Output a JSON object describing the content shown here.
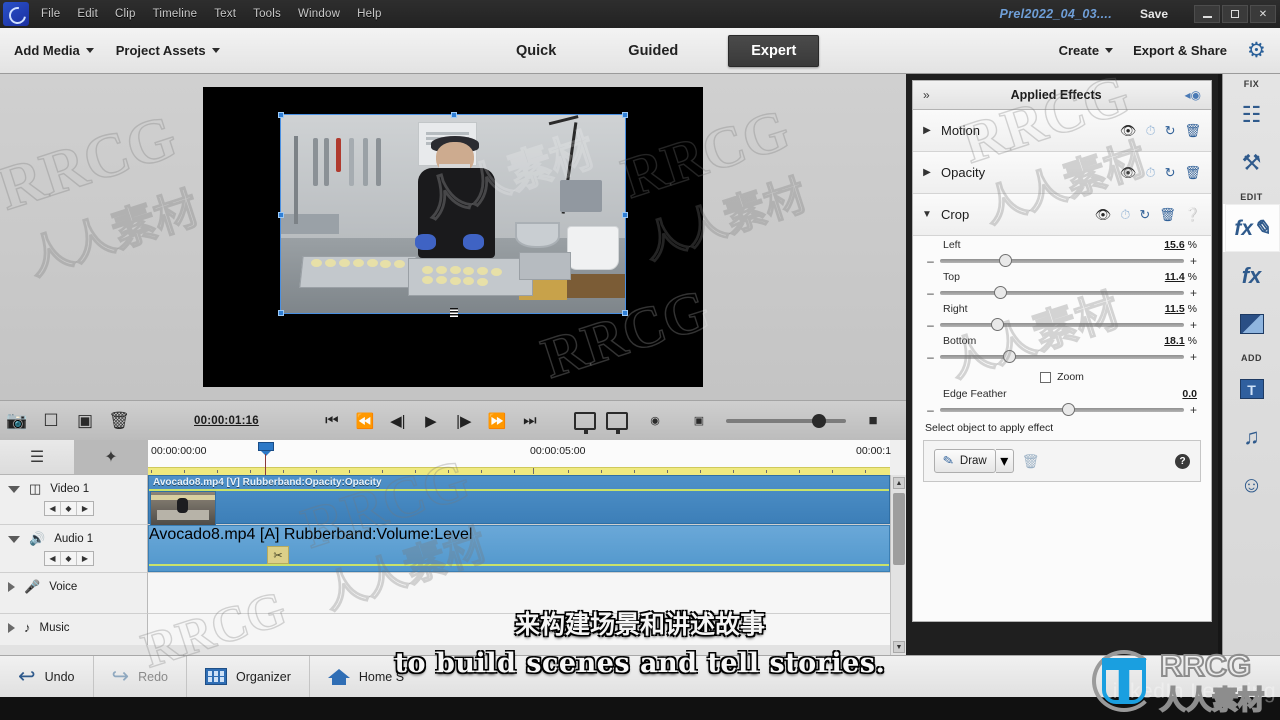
{
  "titlebar": {
    "menu": [
      "File",
      "Edit",
      "Clip",
      "Timeline",
      "Text",
      "Tools",
      "Window",
      "Help"
    ],
    "project_title": "Prel2022_04_03....",
    "save_label": "Save",
    "window_buttons": {
      "minimize": "minimize-icon",
      "maximize": "maximize-icon",
      "close": "✕"
    }
  },
  "actionbar": {
    "add_media": "Add Media",
    "project_assets": "Project Assets",
    "modes": [
      {
        "label": "Quick",
        "active": false
      },
      {
        "label": "Guided",
        "active": false
      },
      {
        "label": "Expert",
        "active": true
      }
    ],
    "create": "Create",
    "export_share": "Export & Share",
    "settings_icon": "gear-icon"
  },
  "monitor": {
    "timecode": "00:00:01:16",
    "tools": [
      "camera-snapshot-icon",
      "duplicate-icon",
      "render-icon",
      "trash-icon"
    ],
    "transport": [
      "go-to-start-icon",
      "rewind-icon",
      "step-back-icon",
      "play-icon",
      "step-forward-icon",
      "fast-forward-icon",
      "go-to-end-icon"
    ],
    "right_tools": [
      "monitor-settings-icon",
      "keyframe-monitor-icon",
      "preview-quality-icon",
      "fit-screen-icon"
    ]
  },
  "timeline": {
    "toolbar": [
      "mixer-icon",
      "transitions-icon"
    ],
    "ruler": {
      "start": "00:00:00:00",
      "mid": "00:00:05:00",
      "end": "00:00:1"
    },
    "tracks": [
      {
        "name": "Video 1",
        "icon": "video-track-icon",
        "expanded": true,
        "clip": "Avocado8.mp4 [V] Rubberband:Opacity:Opacity"
      },
      {
        "name": "Audio 1",
        "icon": "audio-track-icon",
        "expanded": true,
        "clip": "Avocado8.mp4 [A] Rubberband:Volume:Level"
      },
      {
        "name": "Voice",
        "icon": "mic-icon",
        "expanded": false,
        "clip": ""
      },
      {
        "name": "Music",
        "icon": "music-note-icon",
        "expanded": false,
        "clip": ""
      }
    ]
  },
  "applied_effects": {
    "panel_title": "Applied Effects",
    "collapse_icon": "double-chevron-right-icon",
    "keyframe_icon": "keyframe-toggle-icon",
    "effects": [
      {
        "name": "Motion",
        "expanded": false,
        "icons": [
          "eye-icon",
          "keyframe-icon",
          "reset-icon",
          "trash-icon"
        ]
      },
      {
        "name": "Opacity",
        "expanded": false,
        "icons": [
          "eye-icon",
          "keyframe-icon",
          "reset-icon",
          "trash-icon"
        ]
      },
      {
        "name": "Crop",
        "expanded": true,
        "icons": [
          "eye-icon",
          "keyframe-icon",
          "reset-icon",
          "trash-icon",
          "help-icon"
        ]
      }
    ],
    "crop_params": [
      {
        "label": "Left",
        "value": "15.6",
        "unit": "%",
        "pos": 24
      },
      {
        "label": "Top",
        "value": "11.4",
        "unit": "%",
        "pos": 22
      },
      {
        "label": "Right",
        "value": "11.5",
        "unit": "%",
        "pos": 21
      },
      {
        "label": "Bottom",
        "value": "18.1",
        "unit": "%",
        "pos": 26
      }
    ],
    "zoom_checkbox_label": "Zoom",
    "zoom_checked": false,
    "edge_feather": {
      "label": "Edge Feather",
      "value": "0.0",
      "unit": "",
      "pos": 50
    },
    "select_message": "Select object to apply effect",
    "draw": {
      "label": "Draw",
      "pen_icon": "pen-icon",
      "caret": "▾",
      "trash_icon": "trash-icon",
      "help_icon": "help-icon"
    }
  },
  "right_toolbar": [
    {
      "type": "caption",
      "label": "FIX"
    },
    {
      "type": "button",
      "name": "adjustments-icon",
      "glyph": "☰",
      "selected": false
    },
    {
      "type": "button",
      "name": "tools-wrench-icon",
      "glyph": "⚒",
      "selected": false
    },
    {
      "type": "caption",
      "label": "EDIT"
    },
    {
      "type": "button",
      "name": "applied-effects-fx-icon",
      "glyph": "fx",
      "selected": true
    },
    {
      "type": "button",
      "name": "effects-fx-icon",
      "glyph": "fx",
      "selected": false
    },
    {
      "type": "button",
      "name": "transitions-icon",
      "glyph": "◨",
      "selected": false
    },
    {
      "type": "caption",
      "label": "ADD"
    },
    {
      "type": "button",
      "name": "titles-text-icon",
      "glyph": "T",
      "selected": false
    },
    {
      "type": "button",
      "name": "music-icon",
      "glyph": "♫",
      "selected": false
    },
    {
      "type": "button",
      "name": "graphics-smiley-icon",
      "glyph": "☺",
      "selected": false
    }
  ],
  "bottombar": {
    "undo": "Undo",
    "redo": "Redo",
    "organizer": "Organizer",
    "home": "Home S"
  },
  "subtitles": {
    "chinese": "来构建场景和讲述故事",
    "english": "to build scenes and tell stories."
  },
  "watermarks": {
    "brand": "RRCG",
    "brand_cn": "人人素材",
    "platform": "LinkedIn Learning",
    "tiles": [
      "RRCG",
      "人人素材"
    ]
  },
  "colors": {
    "accent_blue": "#2f5a8c",
    "clip_blue": "#4f91c9",
    "titlebar": "#2e2e2e",
    "panel_bg": "#fbfbfb",
    "rubberband": "#c9e26a"
  }
}
